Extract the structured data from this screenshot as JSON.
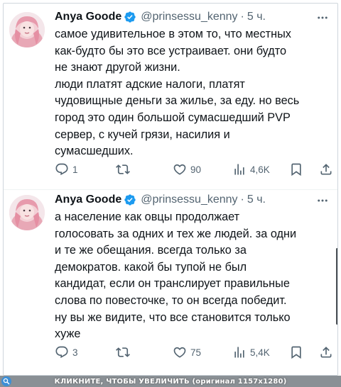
{
  "colors": {
    "text": "#0f1419",
    "secondary": "#536471",
    "verified": "#1d9bf0",
    "divider": "#eff3f4",
    "bottom_bar": "#8a9095"
  },
  "tweets": [
    {
      "author": {
        "name": "Anya Goode",
        "handle": "@prinsessu_kenny",
        "separator": "·",
        "time": "5 ч.",
        "verified_icon": "verified-badge-icon"
      },
      "text_lines": [
        "самое удивительное в этом то, что местных",
        "как-будто бы это все устраивает. они будто",
        "не знают другой жизни.",
        "люди платят адские налоги, платят",
        "чудовищные деньги за жилье, за еду. но весь",
        "город это один большой сумасшедший PVP",
        "сервер, с кучей грязи, насилия и",
        "сумасшедших."
      ],
      "actions": {
        "replies": "1",
        "retweets": "",
        "likes": "90",
        "views": "4,6K"
      }
    },
    {
      "author": {
        "name": "Anya Goode",
        "handle": "@prinsessu_kenny",
        "separator": "·",
        "time": "5 ч.",
        "verified_icon": "verified-badge-icon"
      },
      "text_lines": [
        "а население как овцы продолжает",
        "голосовать за одних и тех же людей. за одни",
        "и те же обещания. всегда только за",
        "демократов. какой бы тупой не был",
        "кандидат, если он транслирует правильные",
        "слова по повесточке, то он всегда победит.",
        "ну вы же видите, что все становится только",
        "хуже"
      ],
      "actions": {
        "replies": "3",
        "retweets": "",
        "likes": "75",
        "views": "5,4K"
      }
    }
  ],
  "bottom_bar": {
    "text": "КЛИКНИТЕ, ЧТОБЫ УВЕЛИЧИТЬ (оригинал 1157x1280)",
    "icon": "magnifier-icon"
  }
}
